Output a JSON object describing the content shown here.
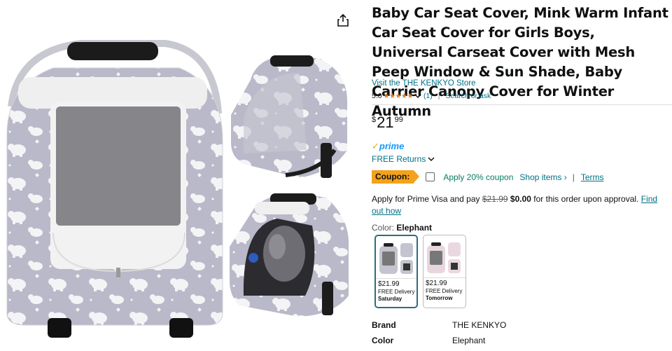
{
  "product": {
    "title": "Baby Car Seat Cover, Mink Warm Infant Car Seat Cover for Girls Boys, Universal Carseat Cover with Mesh Peep Window & Sun Shade, Baby Carrier Canopy Cover for Winter Autumn",
    "store_link": "Visit the THE KENKYO Store",
    "rating_value": "5.0",
    "stars": "★★★★★",
    "review_count": "(1)",
    "separator": "|",
    "search_ask": "Search or ask"
  },
  "price": {
    "symbol": "$",
    "whole": "21",
    "fraction": "99"
  },
  "prime": {
    "check": "✓",
    "label": "prime",
    "returns": "FREE Returns"
  },
  "coupon": {
    "badge": "Coupon:",
    "text": "Apply 20% coupon",
    "shop_items": "Shop items ›",
    "pipe": "|",
    "terms": "Terms"
  },
  "visa": {
    "prefix": "Apply for Prime Visa and pay",
    "old_price": "$21.99",
    "new_price": "$0.00",
    "suffix": "for this order upon approval.",
    "link": "Find out how"
  },
  "color": {
    "label": "Color:",
    "value": "Elephant"
  },
  "swatches": [
    {
      "price": "$21.99",
      "delivery": "FREE Delivery",
      "day": "Saturday",
      "selected": true
    },
    {
      "price": "$21.99",
      "delivery": "FREE Delivery",
      "day": "Tomorrow",
      "selected": false
    }
  ],
  "specs": [
    {
      "key": "Brand",
      "value": "THE KENKYO"
    },
    {
      "key": "Color",
      "value": "Elephant"
    }
  ],
  "colors": {
    "link": "#007185",
    "star": "#de7921",
    "prime_blue": "#1399ff",
    "coupon_bg": "#f4a21a",
    "coupon_green": "#067d62",
    "swatch_selected": "#2e6c80"
  },
  "icons": {
    "share": "share-icon",
    "chevron": "chevron-down-icon",
    "prime_check": "prime-check-icon"
  }
}
